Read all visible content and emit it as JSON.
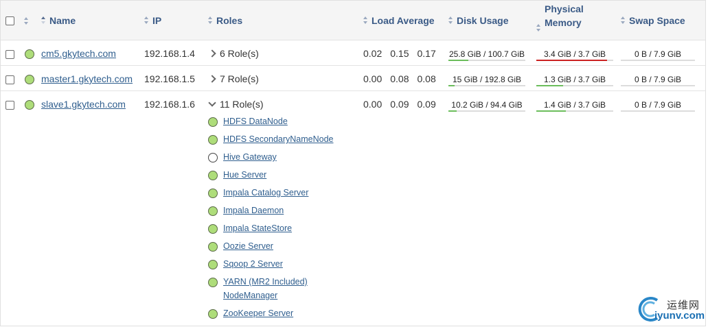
{
  "table": {
    "columns": {
      "name": "Name",
      "ip": "IP",
      "roles": "Roles",
      "load": "Load Average",
      "disk": "Disk Usage",
      "memory_line1": "Physical",
      "memory_line2": "Memory",
      "swap": "Swap Space"
    },
    "hosts": [
      {
        "name": "cm5.gkytech.com",
        "ip": "192.168.1.4",
        "roles_summary": "6 Role(s)",
        "load": [
          "0.02",
          "0.15",
          "0.17"
        ],
        "disk": {
          "text": "25.8 GiB / 100.7 GiB",
          "fraction": 0.256
        },
        "memory": {
          "text": "3.4 GiB / 3.7 GiB",
          "fraction": 0.92
        },
        "swap": {
          "text": "0 B / 7.9 GiB",
          "fraction": 0
        }
      },
      {
        "name": "master1.gkytech.com",
        "ip": "192.168.1.5",
        "roles_summary": "7 Role(s)",
        "load": [
          "0.00",
          "0.08",
          "0.08"
        ],
        "disk": {
          "text": "15 GiB / 192.8 GiB",
          "fraction": 0.078
        },
        "memory": {
          "text": "1.3 GiB / 3.7 GiB",
          "fraction": 0.35
        },
        "swap": {
          "text": "0 B / 7.9 GiB",
          "fraction": 0
        }
      },
      {
        "name": "slave1.gkytech.com",
        "ip": "192.168.1.6",
        "roles_summary": "11 Role(s)",
        "load": [
          "0.00",
          "0.09",
          "0.09"
        ],
        "disk": {
          "text": "10.2 GiB / 94.4 GiB",
          "fraction": 0.108
        },
        "memory": {
          "text": "1.4 GiB / 3.7 GiB",
          "fraction": 0.38
        },
        "swap": {
          "text": "0 B / 7.9 GiB",
          "fraction": 0
        },
        "roles": [
          {
            "name": "HDFS DataNode",
            "status": "good"
          },
          {
            "name": "HDFS SecondaryNameNode",
            "status": "good"
          },
          {
            "name": "Hive Gateway",
            "status": "none"
          },
          {
            "name": "Hue Server",
            "status": "good"
          },
          {
            "name": "Impala Catalog Server",
            "status": "good"
          },
          {
            "name": "Impala Daemon",
            "status": "good"
          },
          {
            "name": "Impala StateStore",
            "status": "good"
          },
          {
            "name": "Oozie Server",
            "status": "good"
          },
          {
            "name": "Sqoop 2 Server",
            "status": "good"
          },
          {
            "name": "YARN (MR2 Included) NodeManager",
            "status": "good"
          },
          {
            "name": "ZooKeeper Server",
            "status": "good"
          }
        ]
      }
    ]
  },
  "watermark": {
    "text_cn": "运维网",
    "text_en": "iyunv.com"
  },
  "colors": {
    "status_good": "#aedd7a",
    "meter_fill": "#6bbd5b",
    "meter_alert": "#cc2222",
    "link": "#2f5e8e"
  }
}
